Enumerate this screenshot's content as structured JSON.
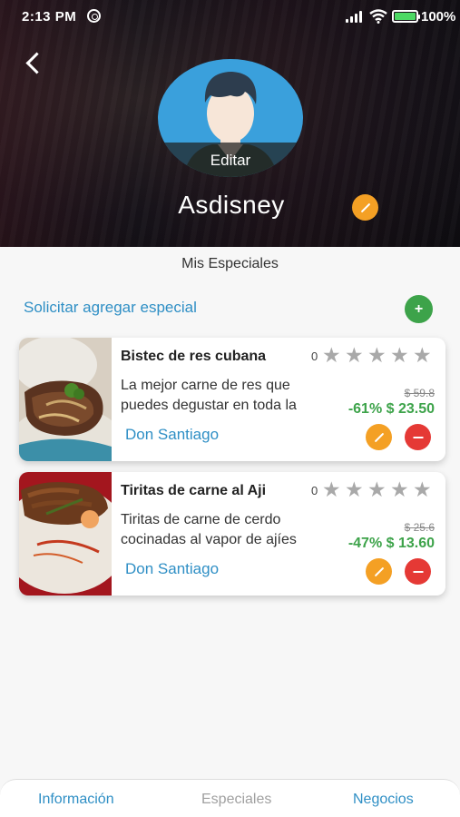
{
  "status_bar": {
    "time": "2:13 PM",
    "battery": "100%"
  },
  "profile": {
    "name": "Asdisney",
    "edit_label": "Editar"
  },
  "section_title": "Mis Especiales",
  "request_link": "Solicitar agregar especial",
  "add_button": "+",
  "specials": [
    {
      "title": "Bistec de res cubana",
      "rating_count": "0",
      "stars": 5,
      "description_line1": "La mejor carne de res que",
      "description_line2": "puedes degustar en toda la",
      "old_price": "$ 59.8",
      "new_price": "-61% $ 23.50",
      "vendor": "Don Santiago"
    },
    {
      "title": "Tiritas de carne al Aji",
      "rating_count": "0",
      "stars": 5,
      "description_line1": "Tiritas de carne de cerdo",
      "description_line2": "cocinadas al vapor de ajíes",
      "old_price": "$ 25.6",
      "new_price": "-47% $ 13.60",
      "vendor": "Don Santiago"
    }
  ],
  "tabs": [
    {
      "label": "Información",
      "state": "active"
    },
    {
      "label": "Especiales",
      "state": "selected"
    },
    {
      "label": "Negocios",
      "state": "active"
    }
  ],
  "colors": {
    "accent": "#2f8fc5",
    "green": "#3da34a",
    "orange": "#f4a024",
    "red": "#e53935"
  }
}
